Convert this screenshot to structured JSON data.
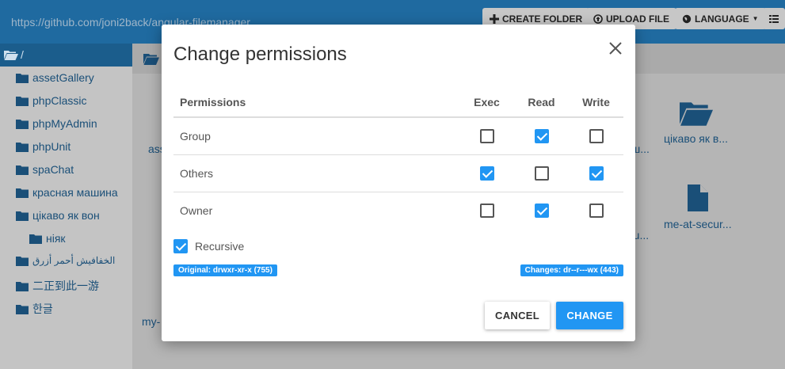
{
  "app": {
    "url": "https://github.com/joni2back/angular-filemanager",
    "toolbar": {
      "create_folder": "CREATE FOLDER",
      "upload_file": "UPLOAD FILE",
      "language": "LANGUAGE"
    },
    "path": "/",
    "sidebar": [
      {
        "label": "assetGallery"
      },
      {
        "label": "phpClassic"
      },
      {
        "label": "phpMyAdmin"
      },
      {
        "label": "phpUnit"
      },
      {
        "label": "spaChat"
      },
      {
        "label": "красная машина"
      },
      {
        "label": "цікаво як вон"
      },
      {
        "label": "ніяк"
      },
      {
        "label": "الخفافيش أحمر أزرق"
      },
      {
        "label": "二正到此一游"
      },
      {
        "label": "한글"
      }
    ],
    "tiles": {
      "folder_label": "цікаво як в...",
      "file_label": "me-at-secur...",
      "partial_1": "ass",
      "partial_2": "my-",
      "partial_3": "ш...",
      "partial_4": "ru..."
    }
  },
  "modal": {
    "title": "Change permissions",
    "headers": {
      "permissions": "Permissions",
      "exec": "Exec",
      "read": "Read",
      "write": "Write"
    },
    "rows": [
      {
        "name": "Group",
        "exec": false,
        "read": true,
        "write": false
      },
      {
        "name": "Others",
        "exec": true,
        "read": false,
        "write": true
      },
      {
        "name": "Owner",
        "exec": false,
        "read": true,
        "write": false
      }
    ],
    "recursive_label": "Recursive",
    "recursive_checked": true,
    "original": "Original: drwxr-xr-x (755)",
    "changes": "Changes: dr--r---wx (443)",
    "cancel": "CANCEL",
    "change": "CHANGE"
  },
  "colors": {
    "accent": "#2196f3",
    "topbar": "#1f6aa0",
    "link": "#1a4f78"
  }
}
